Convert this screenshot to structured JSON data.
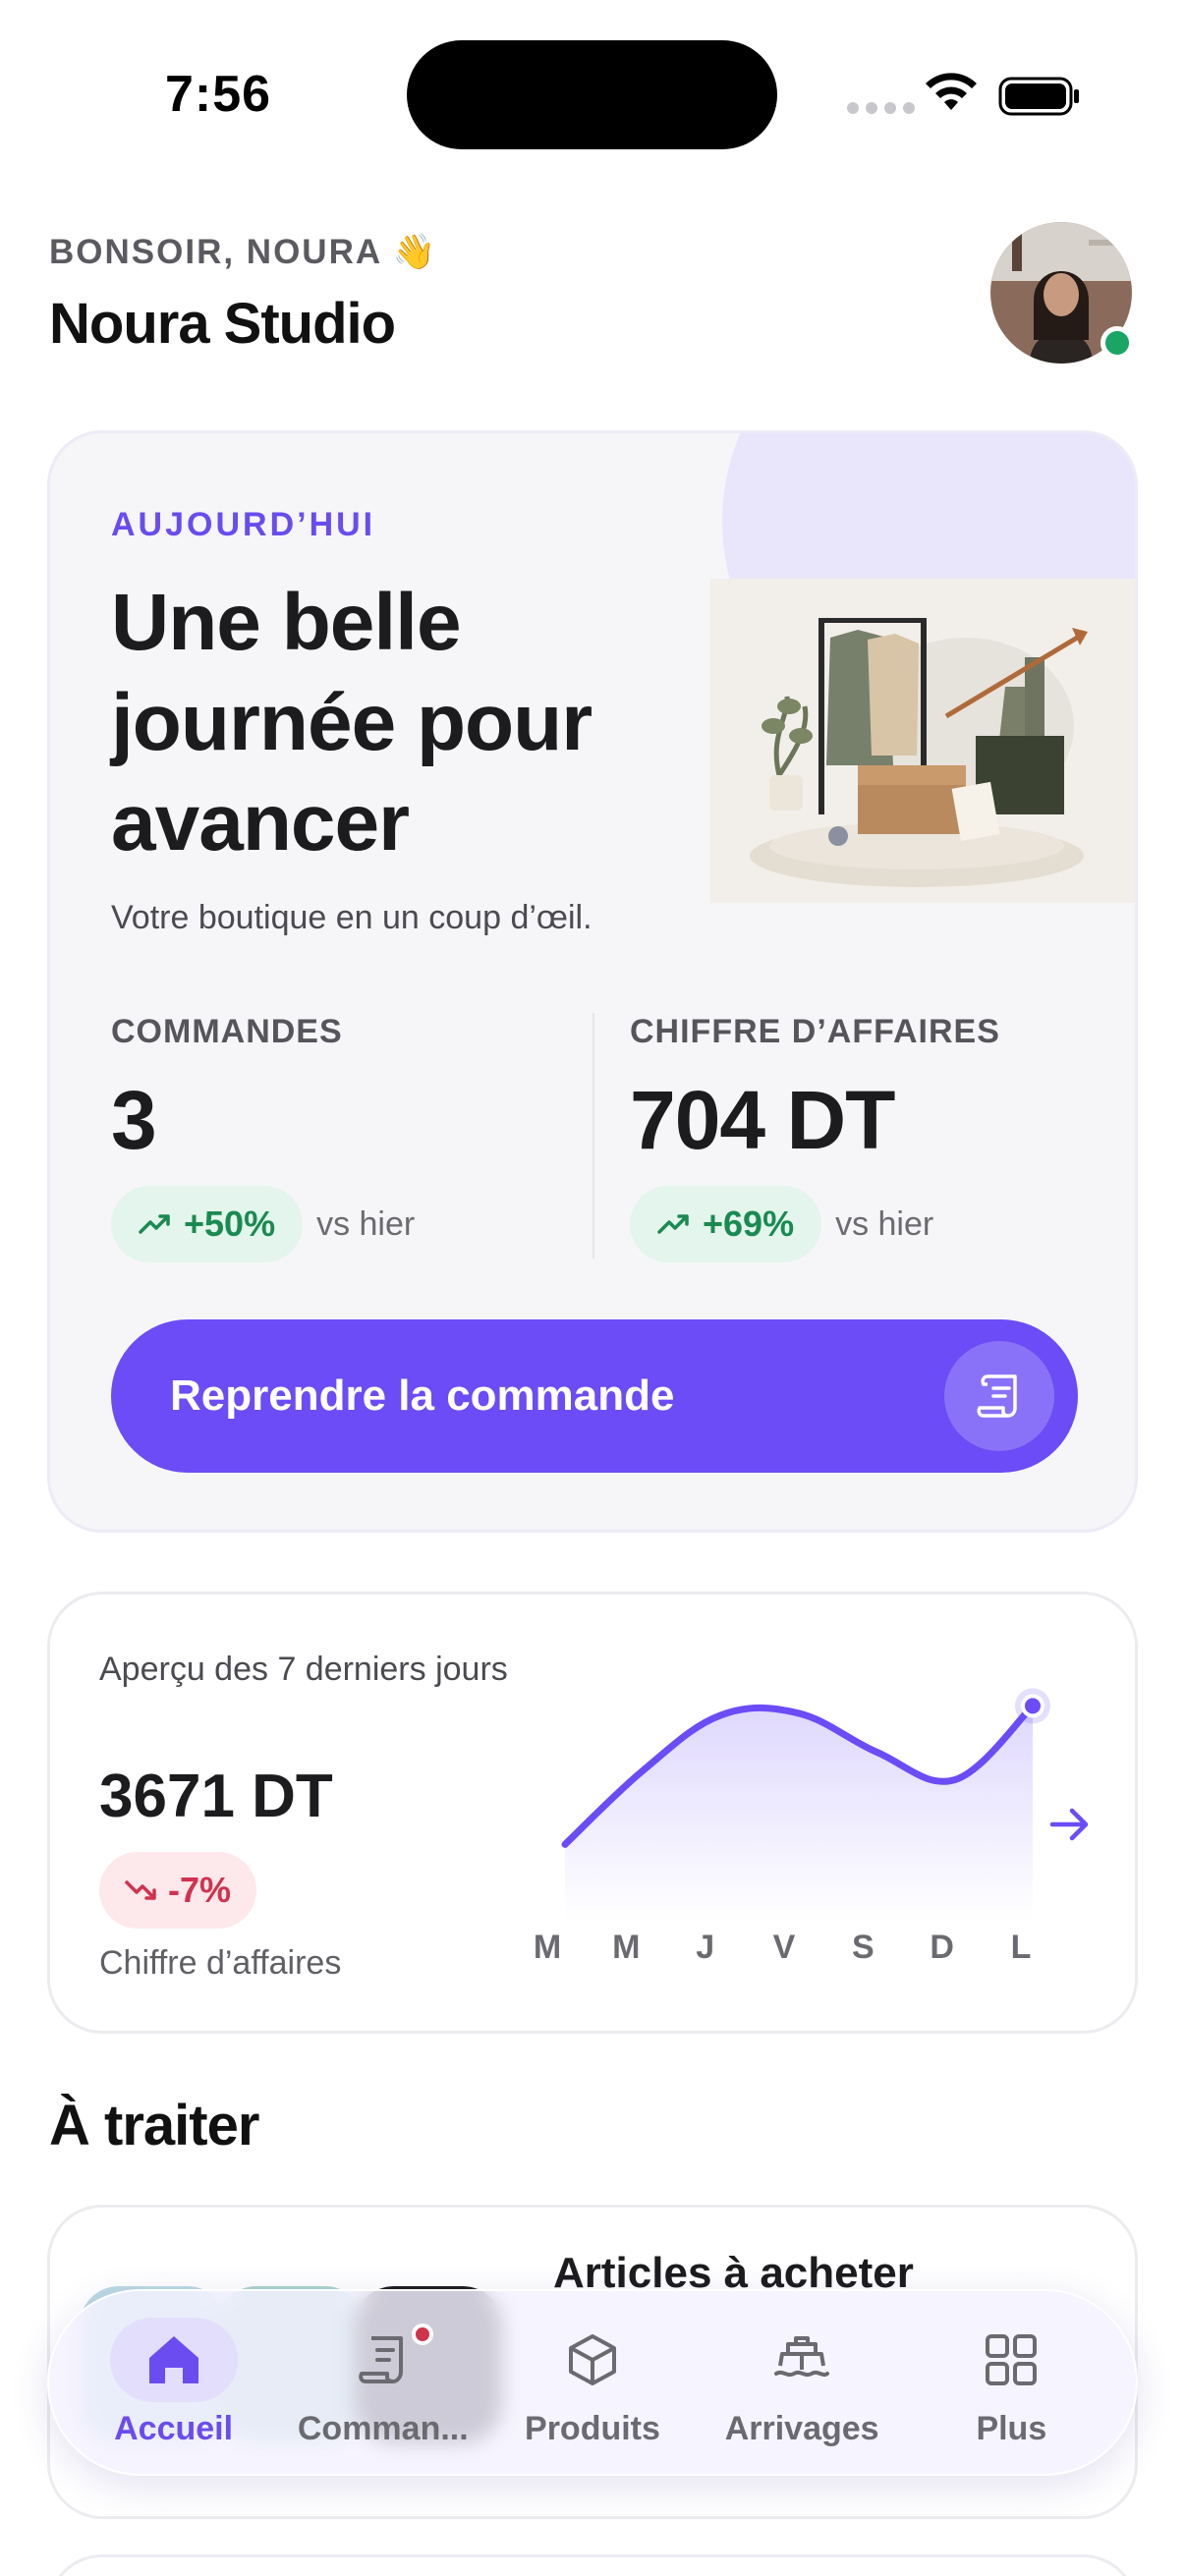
{
  "status_bar": {
    "time": "7:56"
  },
  "header": {
    "greeting": "BONSOIR, NOURA 👋",
    "store_name": "Noura Studio"
  },
  "today": {
    "label": "AUJOURD’HUI",
    "title": "Une belle journée pour avancer",
    "subtitle": "Votre boutique en un coup d’œil.",
    "orders": {
      "label": "COMMANDES",
      "value": "3",
      "delta": "+50%",
      "compare": "vs hier"
    },
    "revenue": {
      "label": "CHIFFRE D’AFFAIRES",
      "value": "704 DT",
      "delta": "+69%",
      "compare": "vs hier"
    },
    "cta_label": "Reprendre la commande"
  },
  "weekly": {
    "title": "Aperçu des 7 derniers jours",
    "value": "3671 DT",
    "delta": "-7%",
    "caption": "Chiffre d’affaires"
  },
  "chart_data": {
    "type": "area",
    "categories": [
      "M",
      "M",
      "J",
      "V",
      "S",
      "D",
      "L"
    ],
    "values": [
      40,
      120,
      180,
      182,
      140,
      110,
      190
    ],
    "title": "",
    "xlabel": "",
    "ylabel": "",
    "grid": false,
    "color": "#6b4cf6"
  },
  "section": {
    "title": "À traiter",
    "first_item_title": "Articles à acheter"
  },
  "tabbar": {
    "tabs": [
      {
        "label": "Accueil",
        "icon": "home-icon",
        "active": true
      },
      {
        "label": "Comman...",
        "icon": "orders-icon",
        "badge": true
      },
      {
        "label": "Produits",
        "icon": "box-icon"
      },
      {
        "label": "Arrivages",
        "icon": "ship-icon"
      },
      {
        "label": "Plus",
        "icon": "grid-icon"
      }
    ]
  },
  "colors": {
    "accent": "#6b4cf6",
    "positive": "#1a8a51",
    "negative": "#d0334c"
  }
}
